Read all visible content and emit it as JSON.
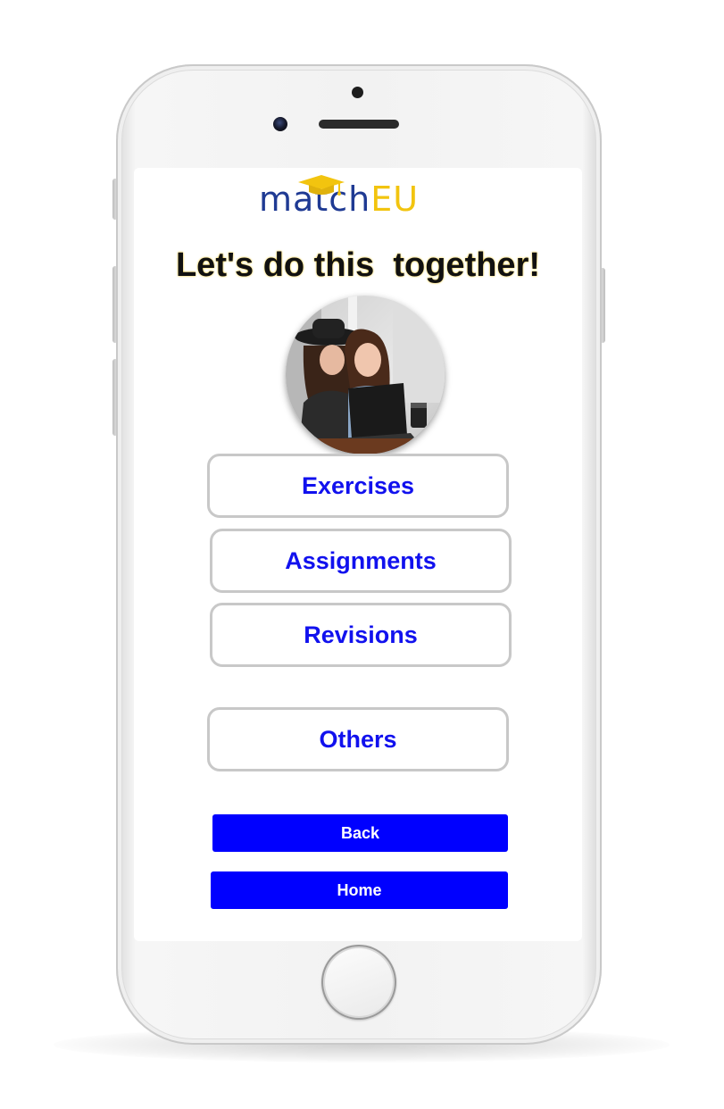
{
  "app": {
    "logo": {
      "part1": "match",
      "part2": "EU"
    },
    "headline": "Let's do this  together!"
  },
  "menu": {
    "items": [
      {
        "label": "Exercises"
      },
      {
        "label": "Assignments"
      },
      {
        "label": "Revisions"
      },
      {
        "label": "Others"
      }
    ]
  },
  "nav": {
    "back_label": "Back",
    "home_label": "Home"
  },
  "colors": {
    "accent": "#0000ff",
    "menu_text": "#1111ee",
    "logo_blue": "#1f3a93",
    "logo_yellow": "#f2c40f",
    "button_border": "#c8c8c8"
  },
  "icons": {
    "logo_cap": "graduation-cap-icon"
  }
}
